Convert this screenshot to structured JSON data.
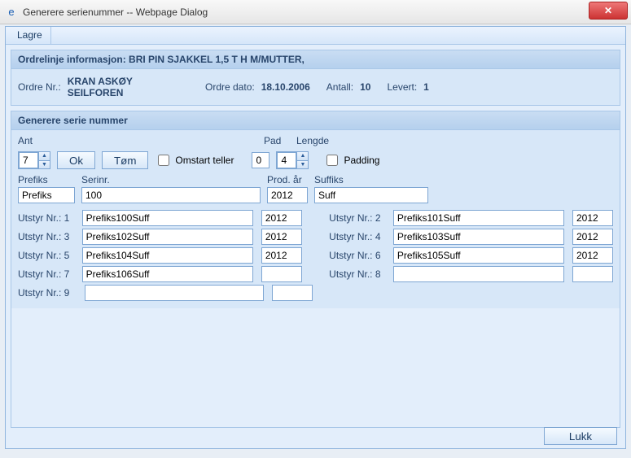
{
  "window": {
    "title": "Generere serienummer -- Webpage Dialog",
    "close_icon": "✕"
  },
  "menu": {
    "lagre": "Lagre"
  },
  "orderinfo": {
    "head_label": "Ordrelinje informasjon:",
    "head_value": "BRI PIN SJAKKEL 1,5 T H M/MUTTER,",
    "ordre_nr_label": "Ordre Nr.:",
    "ordre_nr_value": "KRAN ASKØY SEILFOREN",
    "ordre_dato_label": "Ordre dato:",
    "ordre_dato_value": "18.10.2006",
    "antall_label": "Antall:",
    "antall_value": "10",
    "levert_label": "Levert:",
    "levert_value": "1"
  },
  "gen": {
    "section_title": "Generere serie nummer",
    "ant_label": "Ant",
    "ant_value": "7",
    "ok_label": "Ok",
    "tom_label": "Tøm",
    "omstart_label": "Omstart teller",
    "pad_label": "Pad",
    "pad_value": "0",
    "lengde_label": "Lengde",
    "lengde_value": "4",
    "padding_label": "Padding",
    "prefiks_label": "Prefiks",
    "serienr_label": "Serinr.",
    "prodar_label": "Prod. år",
    "suffiks_label": "Suffiks",
    "prefiks_value": "Prefiks",
    "serienr_value": "100",
    "prodar_value": "2012",
    "suffiks_value": "Suff"
  },
  "items": [
    {
      "lbl": "Utstyr Nr.: 1",
      "serial": "Prefiks100Suff",
      "year": "2012"
    },
    {
      "lbl": "Utstyr Nr.: 2",
      "serial": "Prefiks101Suff",
      "year": "2012"
    },
    {
      "lbl": "Utstyr Nr.: 3",
      "serial": "Prefiks102Suff",
      "year": "2012"
    },
    {
      "lbl": "Utstyr Nr.: 4",
      "serial": "Prefiks103Suff",
      "year": "2012"
    },
    {
      "lbl": "Utstyr Nr.: 5",
      "serial": "Prefiks104Suff",
      "year": "2012"
    },
    {
      "lbl": "Utstyr Nr.: 6",
      "serial": "Prefiks105Suff",
      "year": "2012"
    },
    {
      "lbl": "Utstyr Nr.: 7",
      "serial": "Prefiks106Suff",
      "year": ""
    },
    {
      "lbl": "Utstyr Nr.: 8",
      "serial": "",
      "year": ""
    },
    {
      "lbl": "Utstyr Nr.: 9",
      "serial": "",
      "year": ""
    }
  ],
  "footer": {
    "lukk_label": "Lukk"
  }
}
